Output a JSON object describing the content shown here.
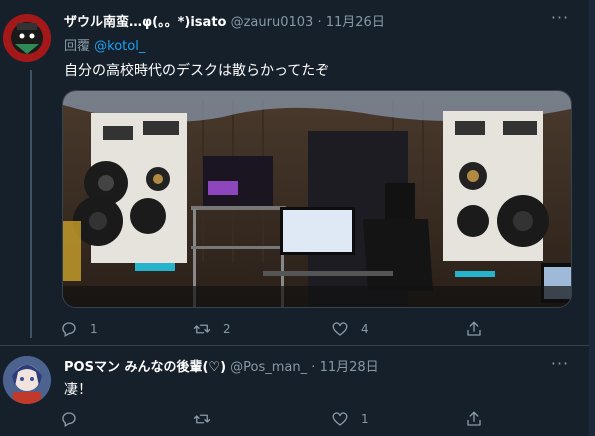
{
  "tweets": [
    {
      "name": "ザウル南蛮…φ(。。*)isato",
      "handle": "@zauru0103",
      "time": "11月26日",
      "reply_label": "回覆",
      "reply_to": "@kotol_",
      "text": "自分の高校時代のデスクは散らかってたぞ",
      "media_alt": "Room with large DIY speaker boxes, monitor and desk",
      "actions": {
        "reply_count": "1",
        "retweet_count": "2",
        "like_count": "4"
      }
    },
    {
      "name": "POSマン みんなの後輩(♡)",
      "handle": "@Pos_man_",
      "time": "11月28日",
      "text": "凄！",
      "actions": {
        "reply_count": "",
        "retweet_count": "",
        "like_count": "1"
      }
    }
  ],
  "icons": {
    "more": "more-horizontal-icon",
    "reply": "reply-icon",
    "retweet": "retweet-icon",
    "like": "heart-icon",
    "share": "share-icon"
  },
  "colors": {
    "background": "#15202b",
    "secondary_text": "#8899a6",
    "link": "#1da1f2",
    "divider": "#38444d"
  }
}
